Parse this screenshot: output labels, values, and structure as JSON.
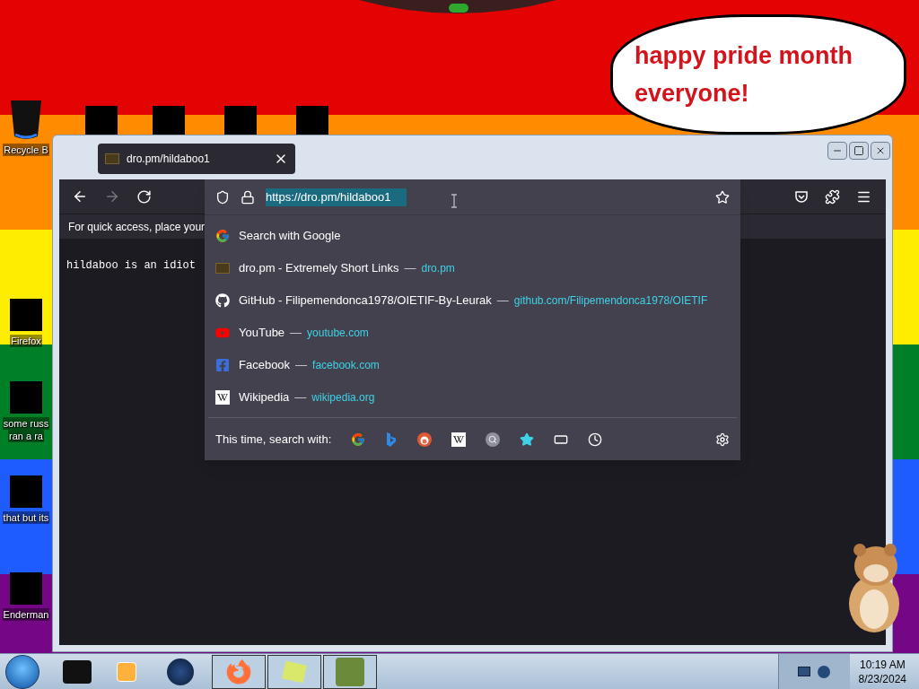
{
  "desktop": {
    "icons": [
      {
        "lines": [
          "Recycle B"
        ]
      },
      {
        "lines": [
          "Firefox"
        ]
      },
      {
        "lines": [
          "some russ",
          "ran a ra"
        ]
      },
      {
        "lines": [
          "that but its"
        ]
      },
      {
        "lines": [
          "Enderman"
        ]
      }
    ],
    "speech_bubble": "happy pride month everyone!"
  },
  "browser": {
    "tab": {
      "title": "dro.pm/hildaboo1",
      "selected": true
    },
    "url": "https://dro.pm/hildaboo1",
    "bookmarks_hint": "For quick access, place your",
    "page_text": "hildaboo is an idiot",
    "suggestions": [
      {
        "kind": "search",
        "title": "Search with Google"
      },
      {
        "kind": "site",
        "title": "dro.pm - Extremely Short Links",
        "url": "dro.pm"
      },
      {
        "kind": "site",
        "title": "GitHub - Filipemendonca1978/OIETIF-By-Leurak",
        "url": "github.com/Filipemendonca1978/OIETIF"
      },
      {
        "kind": "site",
        "title": "YouTube",
        "url": "youtube.com"
      },
      {
        "kind": "site",
        "title": "Facebook",
        "url": "facebook.com"
      },
      {
        "kind": "site",
        "title": "Wikipedia",
        "url": "wikipedia.org"
      }
    ],
    "search_with_label": "This time, search with:",
    "separator": "—"
  },
  "taskbar": {
    "time": "10:19 AM",
    "date": "8/23/2024"
  }
}
